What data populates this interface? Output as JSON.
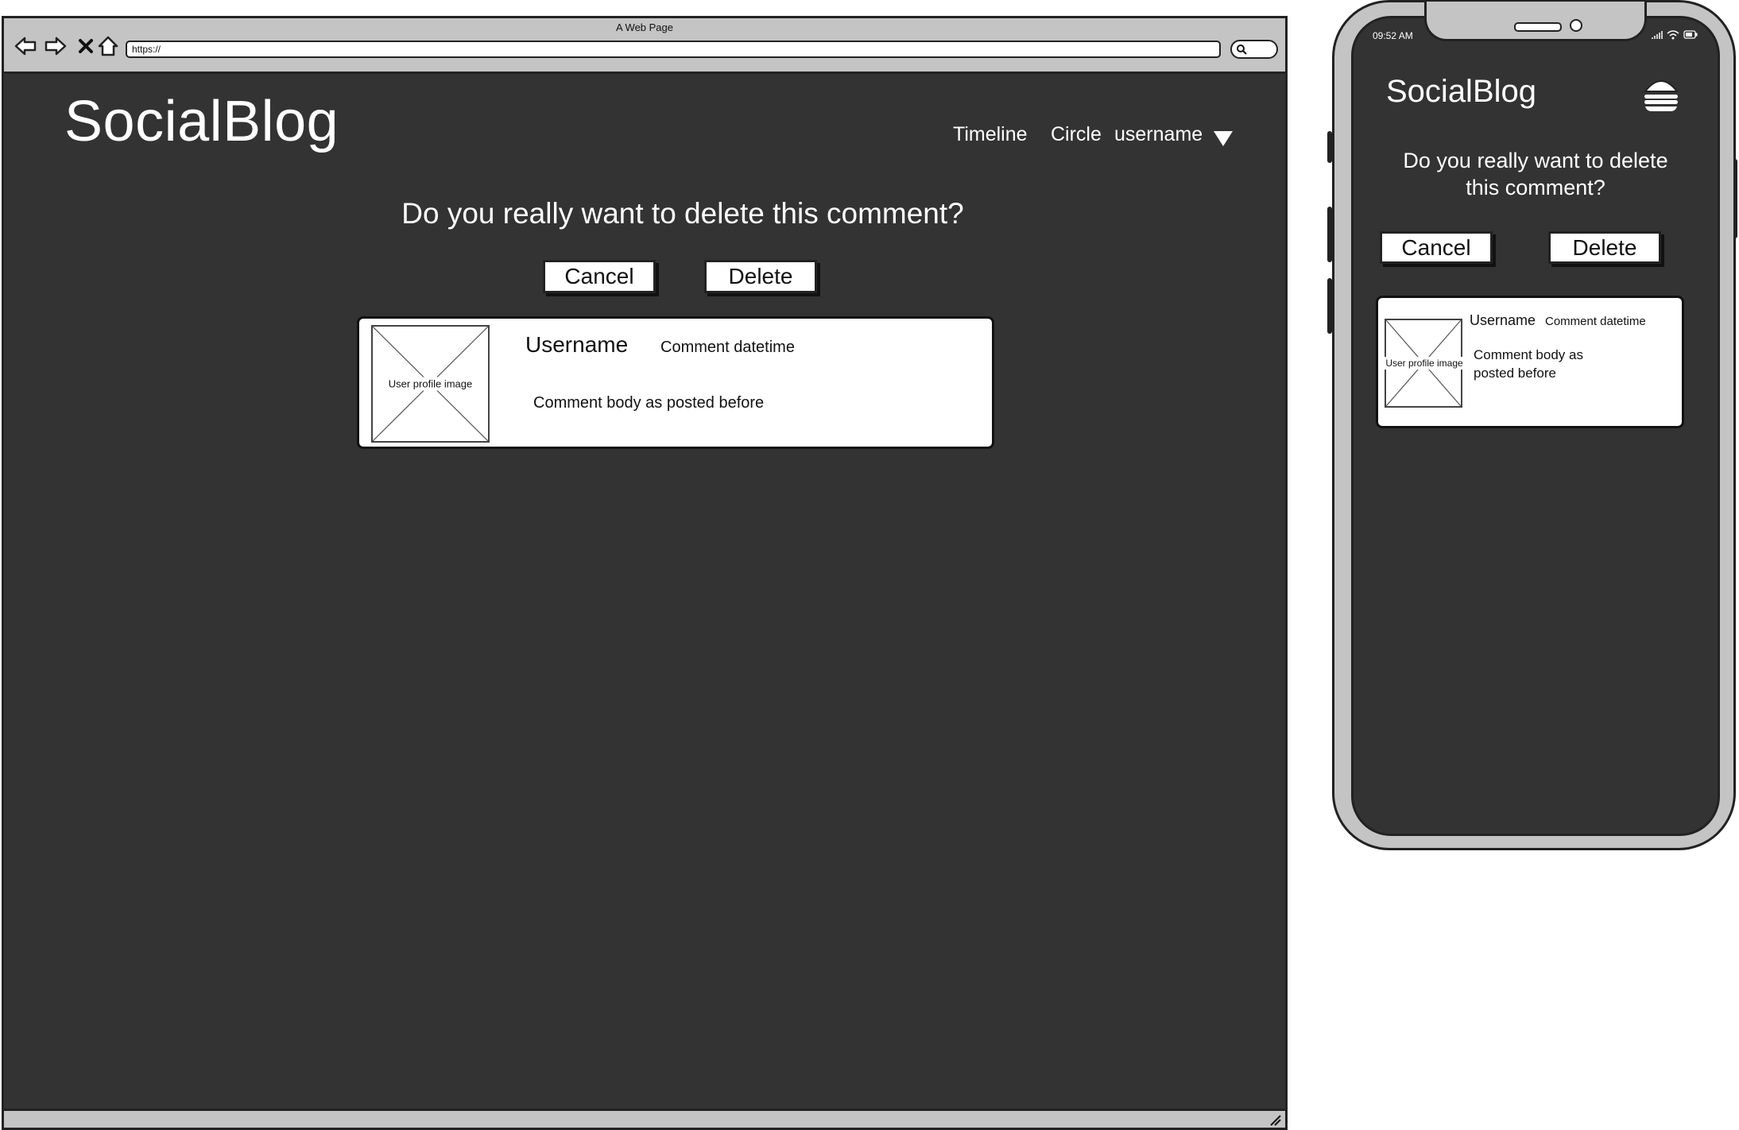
{
  "desktop": {
    "window_title": "A Web Page",
    "url": "https://",
    "logo": "SocialBlog",
    "nav": {
      "timeline": "Timeline",
      "circle": "Circle",
      "username": "username"
    },
    "question": "Do you really want to delete this comment?",
    "cancel_label": "Cancel",
    "delete_label": "Delete",
    "comment": {
      "image_label": "User profile image",
      "username": "Username",
      "datetime": "Comment datetime",
      "body": "Comment body as posted before"
    }
  },
  "mobile": {
    "time": "09:52 AM",
    "logo": "SocialBlog",
    "question_line1": "Do you really want to delete",
    "question_line2": "this comment?",
    "cancel_label": "Cancel",
    "delete_label": "Delete",
    "comment": {
      "image_label": "User profile image",
      "username": "Username",
      "datetime": "Comment datetime",
      "body_line1": "Comment body as",
      "body_line2": "posted before"
    }
  },
  "icons": {
    "back": "back-arrow-icon",
    "forward": "forward-arrow-icon",
    "stop": "close-icon",
    "home": "home-icon",
    "search": "search-icon",
    "dropdown": "caret-down-icon",
    "menu": "hamburger-menu-icon",
    "signal": "signal-icon",
    "wifi": "wifi-icon",
    "battery": "battery-icon"
  },
  "colors": {
    "page_background": "#333333",
    "chrome": "#c4c4c4",
    "card": "#ffffff",
    "text_on_dark": "#ffffff"
  }
}
